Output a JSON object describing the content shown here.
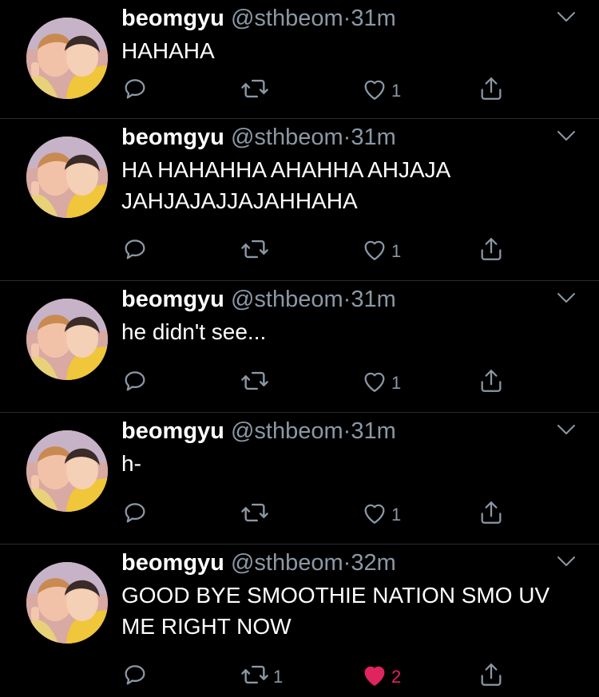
{
  "colors": {
    "background": "#000000",
    "text": "#ffffff",
    "secondary": "#8b98a5",
    "like_active": "#e0245e",
    "divider": "#2a2d30"
  },
  "icons": {
    "reply": "reply-icon",
    "retweet": "retweet-icon",
    "like": "heart-icon",
    "share": "share-icon",
    "menu": "chevron-down-icon"
  },
  "tweets": [
    {
      "name": "beomgyu",
      "handle": "@sthbeom",
      "sep": "·",
      "time": "31m",
      "lines": [
        "HAHAHA"
      ],
      "retweets": "",
      "likes": "1",
      "liked": false
    },
    {
      "name": "beomgyu",
      "handle": "@sthbeom",
      "sep": "·",
      "time": "31m",
      "lines": [
        "HA HAHAHHA AHAHHA AHJAJA",
        "JAHJAJAJJAJAHHAHA"
      ],
      "retweets": "",
      "likes": "1",
      "liked": false
    },
    {
      "name": "beomgyu",
      "handle": "@sthbeom",
      "sep": "·",
      "time": "31m",
      "lines": [
        "he didn't see..."
      ],
      "retweets": "",
      "likes": "1",
      "liked": false
    },
    {
      "name": "beomgyu",
      "handle": "@sthbeom",
      "sep": "·",
      "time": "31m",
      "lines": [
        "h-"
      ],
      "retweets": "",
      "likes": "1",
      "liked": false
    },
    {
      "name": "beomgyu",
      "handle": "@sthbeom",
      "sep": "·",
      "time": "32m",
      "lines": [
        "GOOD BYE SMOOTHIE NATION SMO UV",
        "ME RIGHT NOW"
      ],
      "retweets": "1",
      "likes": "2",
      "liked": true
    }
  ]
}
